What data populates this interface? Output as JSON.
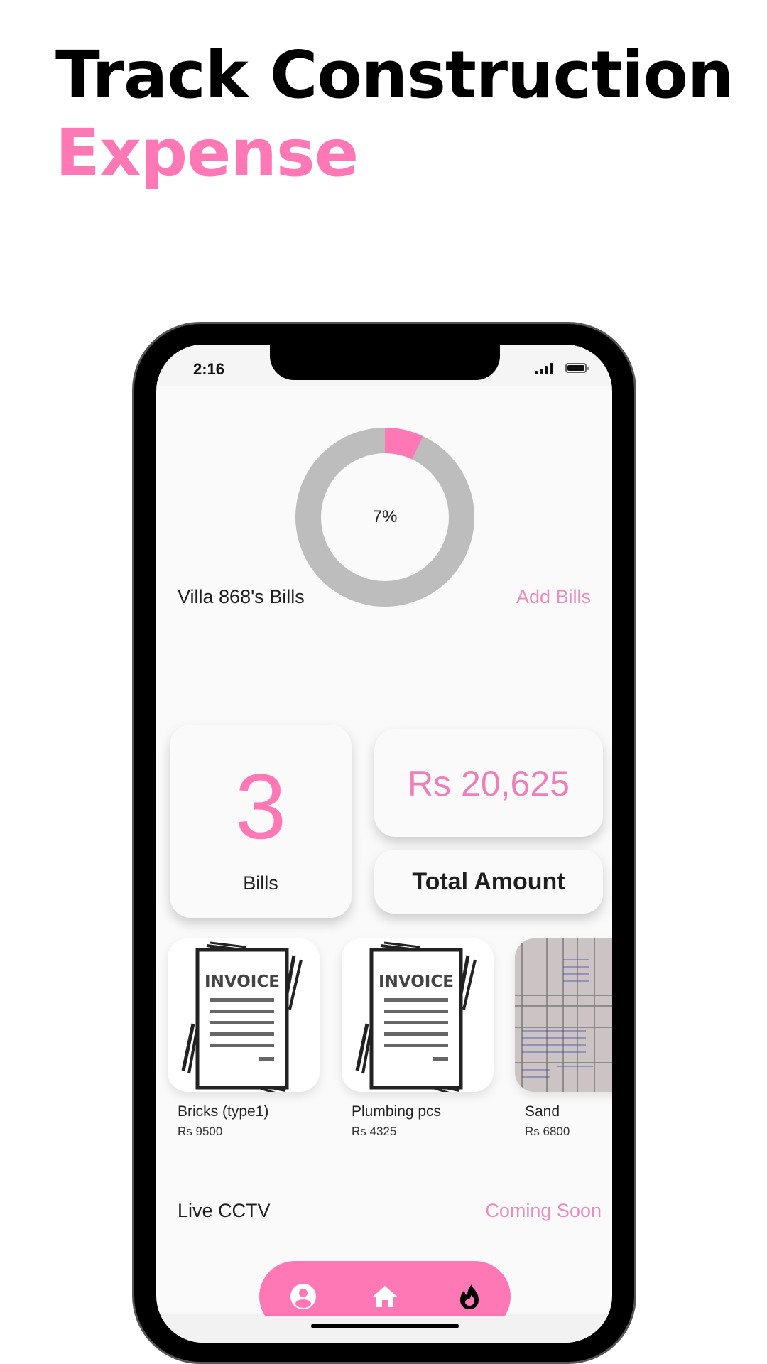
{
  "headline": {
    "line1": "Track Construction",
    "line2": "Expense"
  },
  "colors": {
    "accent": "#ff78b6",
    "donut_track": "#bdbdbd",
    "text": "#1e1e1e"
  },
  "status_bar": {
    "time": "2:16",
    "signal_icon": "signal-icon",
    "battery_icon": "battery-icon"
  },
  "progress": {
    "label": "7%",
    "fraction": 0.07
  },
  "bills_section": {
    "title": "Villa 868's Bills",
    "action": "Add Bills"
  },
  "summary": {
    "bill_count": "3",
    "bill_count_label": "Bills",
    "total_amount": "Rs 20,625",
    "total_label": "Total Amount"
  },
  "bills": [
    {
      "name": "Bricks (type1)",
      "amount": "Rs 9500",
      "thumb": "invoice-icon",
      "thumb_text": "INVOICE"
    },
    {
      "name": "Plumbing pcs",
      "amount": "Rs 4325",
      "thumb": "invoice-icon",
      "thumb_text": "INVOICE"
    },
    {
      "name": "Sand",
      "amount": "Rs 6800",
      "thumb": "receipt-photo"
    }
  ],
  "cctv_section": {
    "title": "Live CCTV",
    "action": "Coming Soon"
  },
  "bottom_nav": [
    {
      "icon": "account-circle-icon"
    },
    {
      "icon": "home-icon"
    },
    {
      "icon": "flame-icon"
    }
  ]
}
